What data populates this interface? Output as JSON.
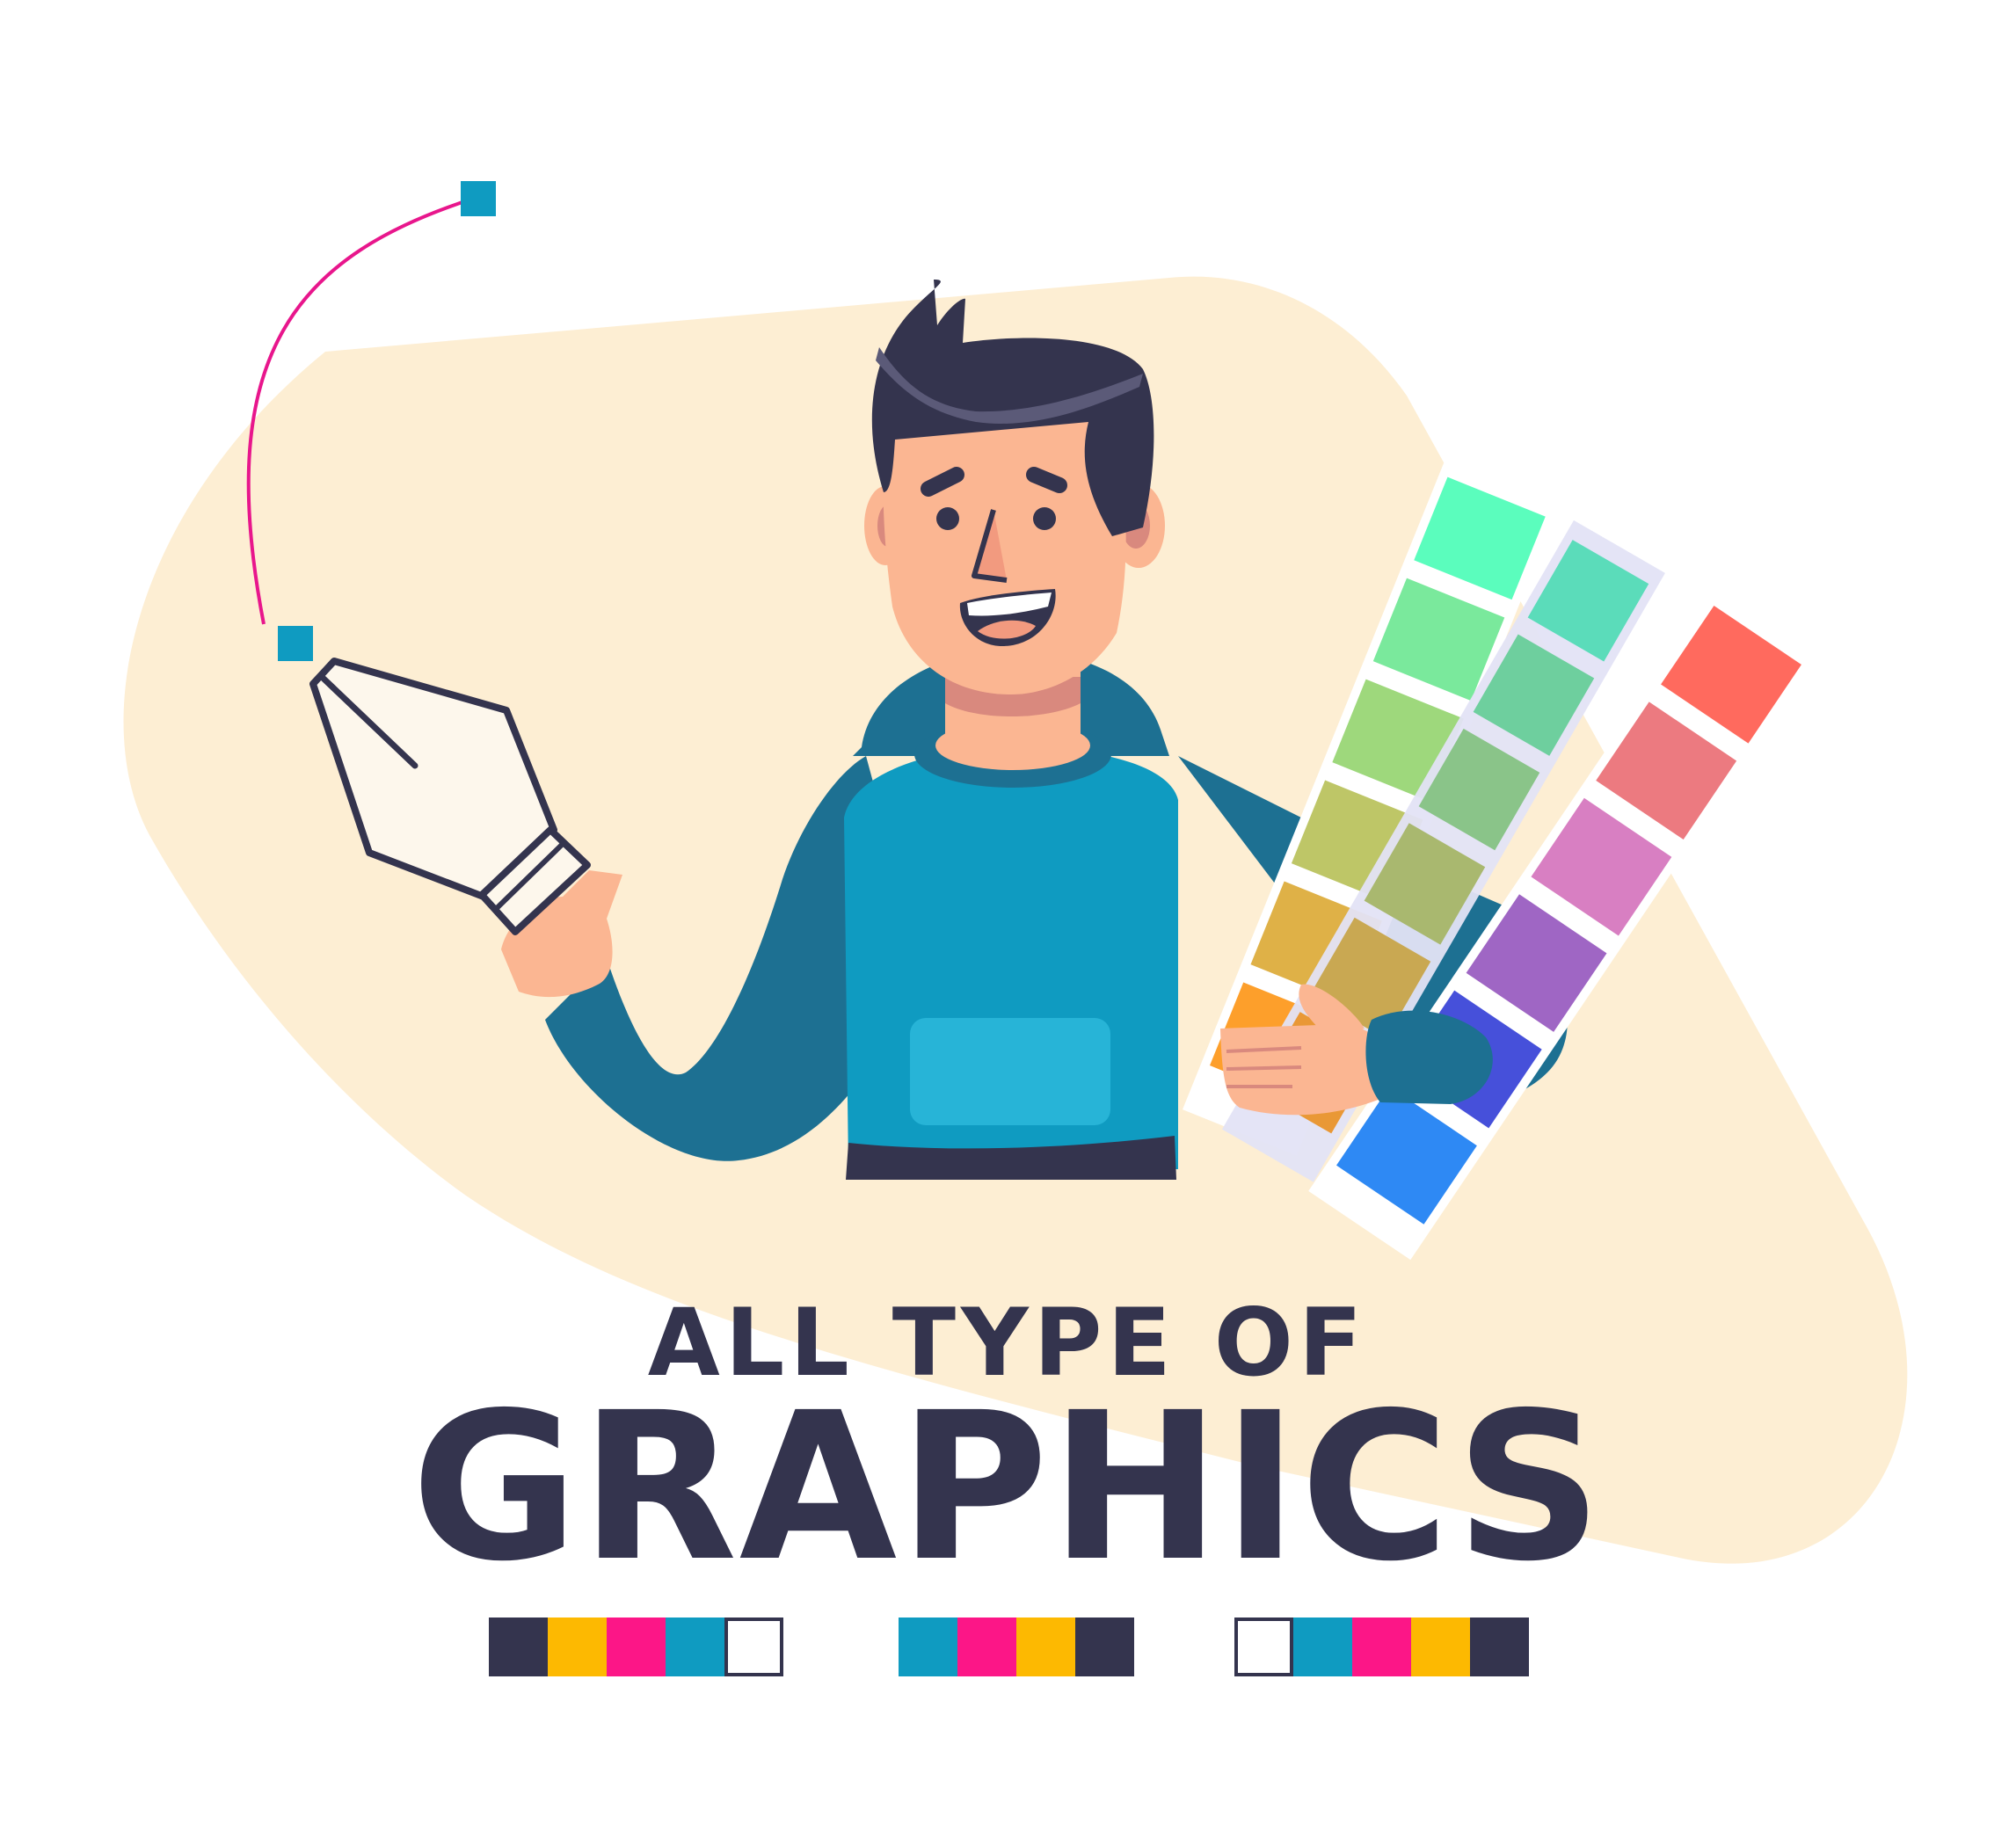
{
  "headline": {
    "line1": "ALL TYPE OF",
    "line2": "GRAPHICS"
  },
  "colors": {
    "background": "#ffffff",
    "blob": "#fdeed3",
    "ink": "#34344e",
    "skin": "#fbb692",
    "skin_shadow": "#d9897e",
    "hoodie": "#0f9bc1",
    "hoodie_dark": "#1d7092",
    "pocket": "#27b4d7",
    "hair_highlight": "#5b5a78",
    "cmyk_cyan": "#0f9bc1",
    "cmyk_magenta": "#fc1687",
    "cmyk_yellow": "#fdb901",
    "cmyk_key": "#34344e",
    "curve": "#e8168c"
  },
  "icons": [
    "pen-tool-icon",
    "bezier-anchor-icon",
    "color-swatch-fan-icon"
  ],
  "swatch_fans": {
    "back": [
      "#5bfdbd",
      "#7ae99c",
      "#9ed87c",
      "#bec667",
      "#dfb147",
      "#fd9f2b"
    ],
    "middle": [
      "#5bdcba",
      "#6ecf9e",
      "#8ac489",
      "#a9b86f",
      "#c9a852",
      "#e99836"
    ],
    "front": [
      "#ff6a5e",
      "#ec7a80",
      "#d87fc2",
      "#9f66c4",
      "#4650da",
      "#2e89f4"
    ]
  },
  "palette_groups": [
    [
      "#34344e",
      "#fdb901",
      "#fc1687",
      "#0f9bc1",
      "#ffffff"
    ],
    [
      "#0f9bc1",
      "#fc1687",
      "#fdb901",
      "#34344e"
    ],
    [
      "#ffffff",
      "#0f9bc1",
      "#fc1687",
      "#fdb901",
      "#34344e"
    ]
  ]
}
